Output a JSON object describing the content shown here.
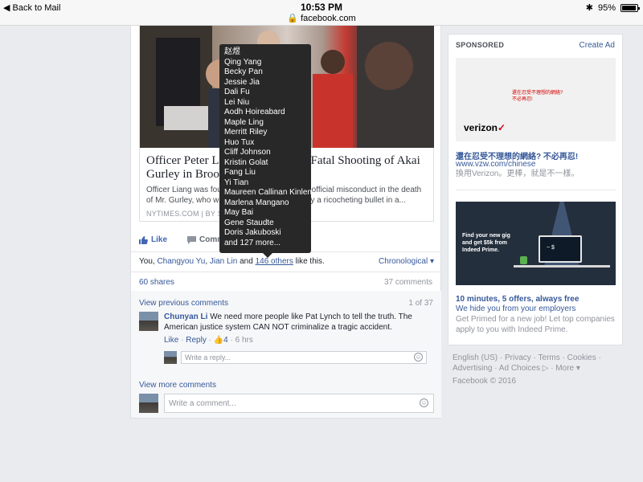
{
  "status_bar": {
    "back_label": "◀ Back to Mail",
    "time": "10:53 PM",
    "url": "🔒 facebook.com",
    "bluetooth": "✱",
    "battery": "95%",
    "battery_level": 0.95
  },
  "post": {
    "link_title": "Officer Peter L… Fatal Shooting of Akai Gurley in Broo…",
    "link_title_line1_left": "Officer Peter L",
    "link_title_line1_right": "Fatal Shooting of Akai",
    "link_title_line2": "Gurley in Broo",
    "link_desc_line1_left": "Officer Liang was foun",
    "link_desc_line1_right": "d official misconduct in the death",
    "link_desc_line2_left": "of Mr. Gurley, who was",
    "link_desc_line2_right": "by a ricocheting bullet in a...",
    "link_source": "NYTIMES.COM  |  BY S",
    "like_label": "Like",
    "comment_label": "Comm",
    "likes": {
      "prefix": "You, ",
      "name1": "Changyou Yu",
      "sep": ", ",
      "name2": "Jian Lin",
      "and": " and ",
      "others": "146 others",
      "suffix": " like this."
    },
    "sort_label": "Chronological ▾",
    "shares": "60 shares",
    "comment_count": "37 comments",
    "view_previous": "View previous comments",
    "page_count": "1 of 37",
    "comment": {
      "author": "Chunyan Li",
      "text": " We need more people like Pat Lynch to tell the truth. The American justice system CAN NOT criminalize a tragic accident.",
      "like": "Like",
      "reply": "Reply",
      "reactions": "👍4",
      "time": "6 hrs",
      "sep": " · "
    },
    "reply_placeholder": "Write a reply...",
    "view_more": "View more comments",
    "comment_placeholder": "Write a comment..."
  },
  "likers_tooltip": [
    "赵煜",
    "Qing Yang",
    "Becky Pan",
    "Jessie Jia",
    "Dali Fu",
    "Lei Niu",
    "Aodh Hoireabard",
    "Maple Ling",
    "Merritt Riley",
    "Huo Tux",
    "Cliff Johnson",
    "Kristin Golat",
    "Fang Liu",
    "Yi Tian",
    "Maureen Callinan Kinlen",
    "Marlena Mangano",
    "May Bai",
    "Gene Staudte",
    "Doris Jakuboski",
    "and 127 more..."
  ],
  "sidebar": {
    "sponsored_label": "SPONSORED",
    "create_ad": "Create Ad",
    "ad1": {
      "image_text_1": "還在忍受不理想的網絡?",
      "image_text_2": "不必再忍!",
      "logo": "verizon",
      "logo_mark": "✓",
      "title": "還在忍受不理想的網絡? 不必再忍!",
      "url": "www.vzw.com/chinese",
      "desc": "換用Verizon。更棒，就是不一樣。"
    },
    "ad2": {
      "image_text": "Find your new gig and get $5k from Indeed Prime.",
      "screen_text": "~ $",
      "title": "10 minutes, 5 offers, always free",
      "url": "We hide you from your employers",
      "desc": "Get Primed for a new job! Let top companies apply to you with Indeed Prime."
    }
  },
  "footer": {
    "links": "English (US) · Privacy · Terms · Cookies · Advertising · Ad Choices ▷ · More ▾",
    "copyright": "Facebook © 2016"
  },
  "colors": {
    "facebook_blue": "#365899",
    "link_blue": "#4267b2",
    "background": "#e9ebee",
    "tooltip_bg": "#282828",
    "verizon_red": "#cd040b"
  }
}
